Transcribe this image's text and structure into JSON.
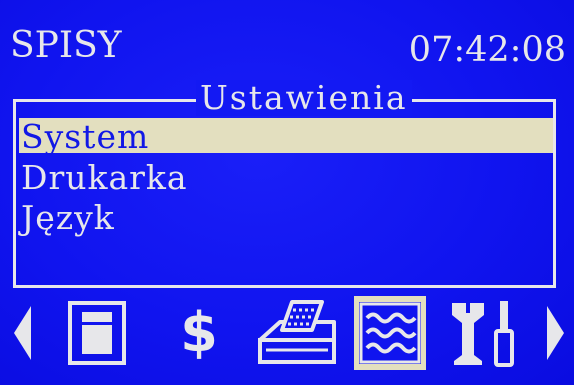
{
  "header": {
    "title": "SPISY",
    "clock": "07:42:08"
  },
  "menu": {
    "title": "Ustawienia",
    "items": [
      {
        "label": "System",
        "selected": true
      },
      {
        "label": "Drukarka",
        "selected": false
      },
      {
        "label": "Język",
        "selected": false
      }
    ]
  },
  "toolbar": {
    "items": [
      {
        "icon": "arrow-left-icon"
      },
      {
        "icon": "document-icon"
      },
      {
        "icon": "dollar-icon",
        "glyph": "$"
      },
      {
        "icon": "cash-register-icon"
      },
      {
        "icon": "report-icon",
        "active": true
      },
      {
        "icon": "tools-icon"
      },
      {
        "icon": "arrow-right-icon"
      }
    ]
  },
  "colors": {
    "background": "#1014ef",
    "foreground": "#e7e7ea",
    "highlight": "#e3dfbf"
  }
}
